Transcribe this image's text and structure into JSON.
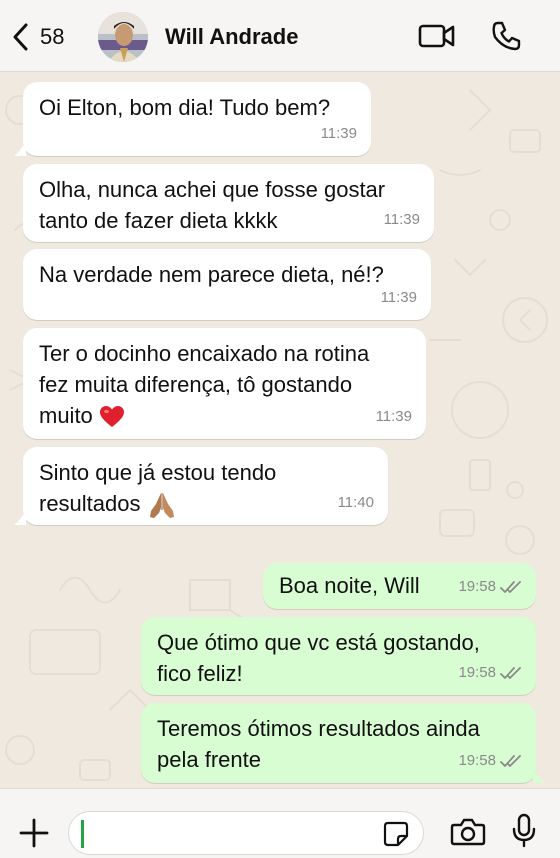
{
  "header": {
    "back_count": "58",
    "contact_name": "Will Andrade"
  },
  "messages": [
    {
      "dir": "in",
      "lines": [
        "Oi Elton, bom dia! Tudo bem?"
      ],
      "time": "11:39"
    },
    {
      "dir": "in",
      "lines": [
        "Olha, nunca achei que fosse gostar",
        "tanto de fazer dieta kkkk"
      ],
      "time": "11:39"
    },
    {
      "dir": "in",
      "lines": [
        "Na verdade nem parece dieta, né!?"
      ],
      "time": "11:39"
    },
    {
      "dir": "in",
      "lines": [
        "Ter o docinho encaixado na rotina",
        "fez muita diferença, tô gostando",
        "muito"
      ],
      "emoji": "red-heart",
      "time": "11:39"
    },
    {
      "dir": "in",
      "lines": [
        "Sinto que já estou tendo",
        "resultados"
      ],
      "emoji": "folded-hands",
      "time": "11:40"
    },
    {
      "dir": "out",
      "lines": [
        "Boa noite, Will"
      ],
      "time": "19:58",
      "status": "read"
    },
    {
      "dir": "out",
      "lines": [
        "Que ótimo que vc está gostando,",
        "fico feliz!"
      ],
      "time": "19:58",
      "status": "read"
    },
    {
      "dir": "out",
      "lines": [
        "Teremos ótimos resultados ainda",
        "pela frente"
      ],
      "time": "19:58",
      "status": "read"
    }
  ],
  "composer": {
    "value": ""
  },
  "colors": {
    "incoming_bubble": "#ffffff",
    "outgoing_bubble": "#d9fdd3",
    "wallpaper": "#efe9df",
    "read_ticks": "#8a8a8a"
  },
  "icons": [
    "chevron-left-icon",
    "video-call-icon",
    "phone-icon",
    "plus-icon",
    "sticker-icon",
    "camera-icon",
    "microphone-icon",
    "double-check-icon",
    "heart-emoji",
    "folded-hands-emoji"
  ]
}
